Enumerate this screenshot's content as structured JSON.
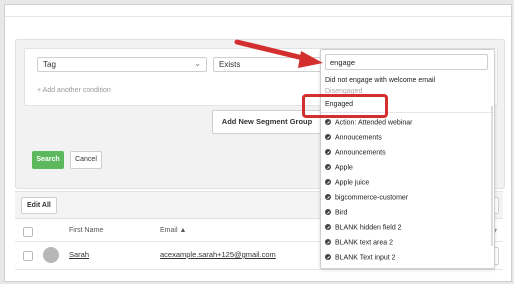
{
  "condition": {
    "field_label": "Tag",
    "operator_label": "Exists",
    "add_condition_label": "+ Add another condition"
  },
  "buttons": {
    "segment_group": "Add New Segment Group",
    "search": "Search",
    "cancel": "Cancel",
    "edit_all": "Edit All"
  },
  "dropdown": {
    "search_value": "engage",
    "plain_options": [
      "Did not engage with welcome email",
      "Disengaged",
      "Engaged"
    ],
    "options": [
      "Action: Attended webinar",
      "Annoucements",
      "Announcements",
      "Apple",
      "Apple juice",
      "bigcommerce-customer",
      "Bird",
      "BLANK hidden field 2",
      "BLANK text area 2",
      "BLANK Text input 2"
    ]
  },
  "table": {
    "headers": {
      "first_name": "First Name",
      "email": "Email ▲"
    },
    "rows": [
      {
        "first_name": "Sarah",
        "email": "acexample.sarah+125@gmail.com"
      }
    ]
  },
  "annotation": {
    "highlight_color": "#d32f2f",
    "arrow_color": "#d32f2f"
  },
  "colors": {
    "search_button": "#5cb85c"
  }
}
